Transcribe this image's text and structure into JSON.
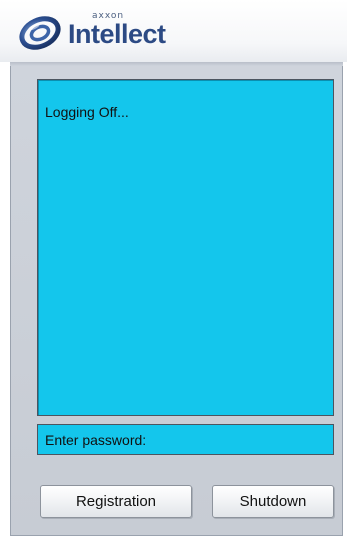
{
  "logo": {
    "brand_small": "axxon",
    "brand_main": "Intellect",
    "icon": "orbit-logo-icon"
  },
  "message": {
    "text": "Logging Off..."
  },
  "password": {
    "label": "Enter password:"
  },
  "buttons": {
    "registration_label": "Registration",
    "shutdown_label": "Shutdown"
  },
  "colors": {
    "message_bg": "#14c6ec",
    "panel_bg": "#cfd4dc",
    "logo_text": "#2c4a84"
  }
}
